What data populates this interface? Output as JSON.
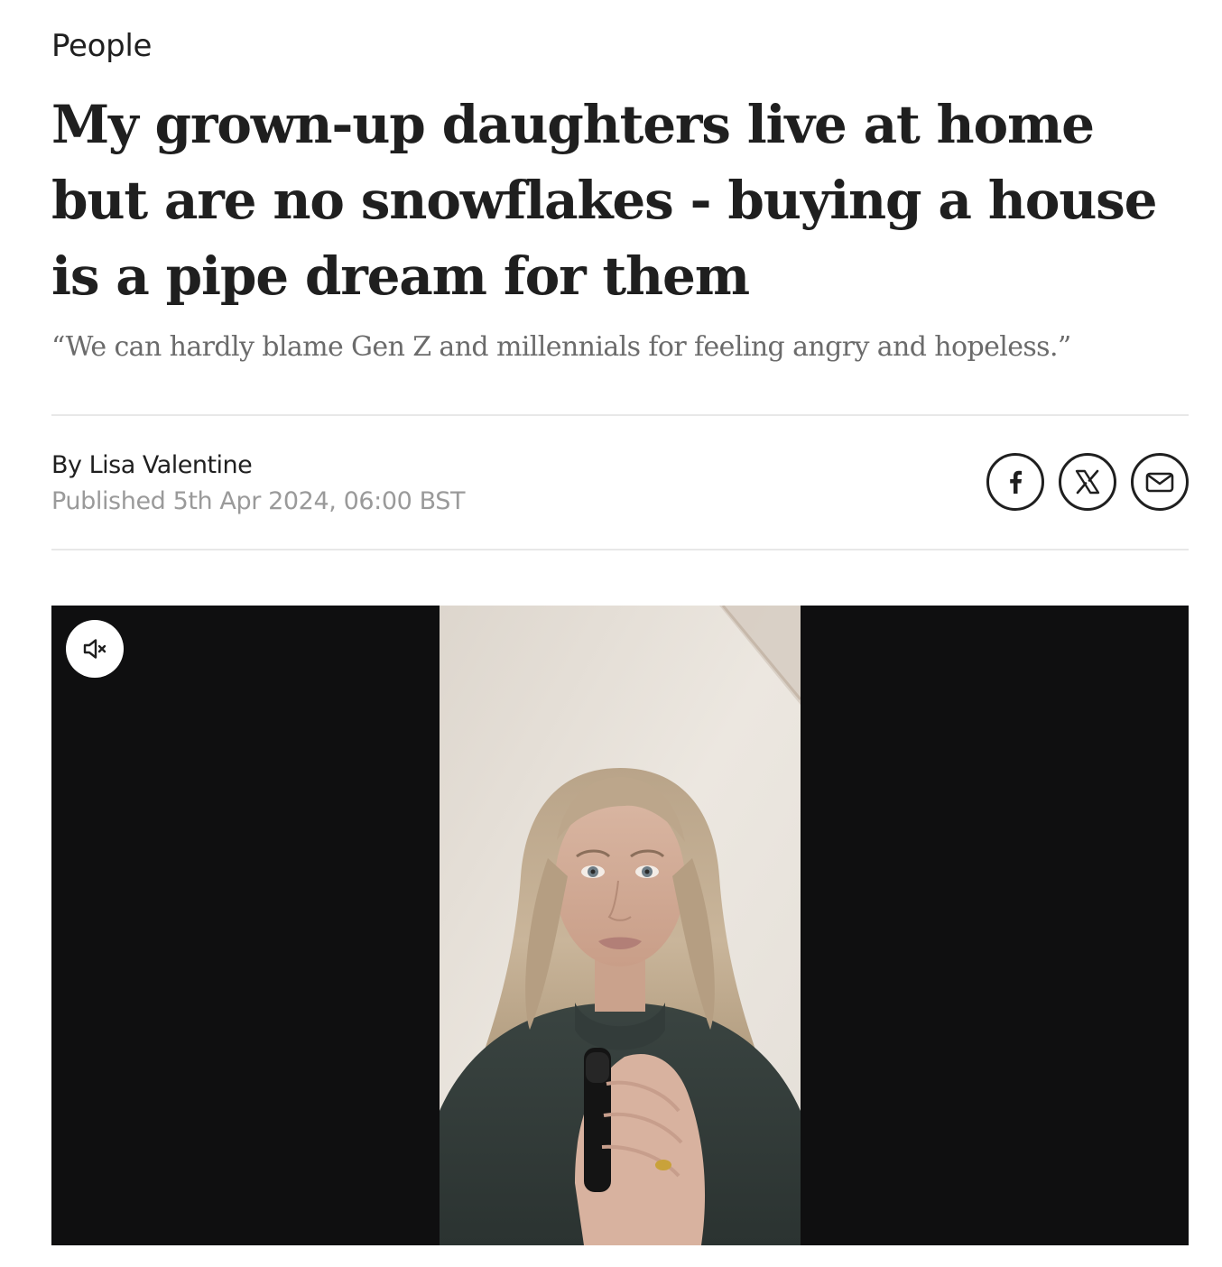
{
  "section": {
    "label": "People"
  },
  "article": {
    "headline": "My grown-up daughters live at home but are no snowflakes - buying a house is a pipe dream for them",
    "standfirst": "“We can hardly blame Gen Z and millennials for feeling angry and hopeless.”",
    "byline": "By Lisa Valentine",
    "published": "Published 5th Apr 2024, 06:00 BST"
  },
  "share": {
    "buttons": [
      {
        "icon": "facebook-icon"
      },
      {
        "icon": "x-icon"
      },
      {
        "icon": "email-icon"
      }
    ]
  },
  "video": {
    "mute_icon": "muted-speaker-icon",
    "muted": true
  },
  "colors": {
    "text": "#1f1f1f",
    "muted_text": "#6b6b6b",
    "date_text": "#9a9a9a",
    "divider": "#e8e8e8",
    "video_background": "#0f0f10"
  }
}
